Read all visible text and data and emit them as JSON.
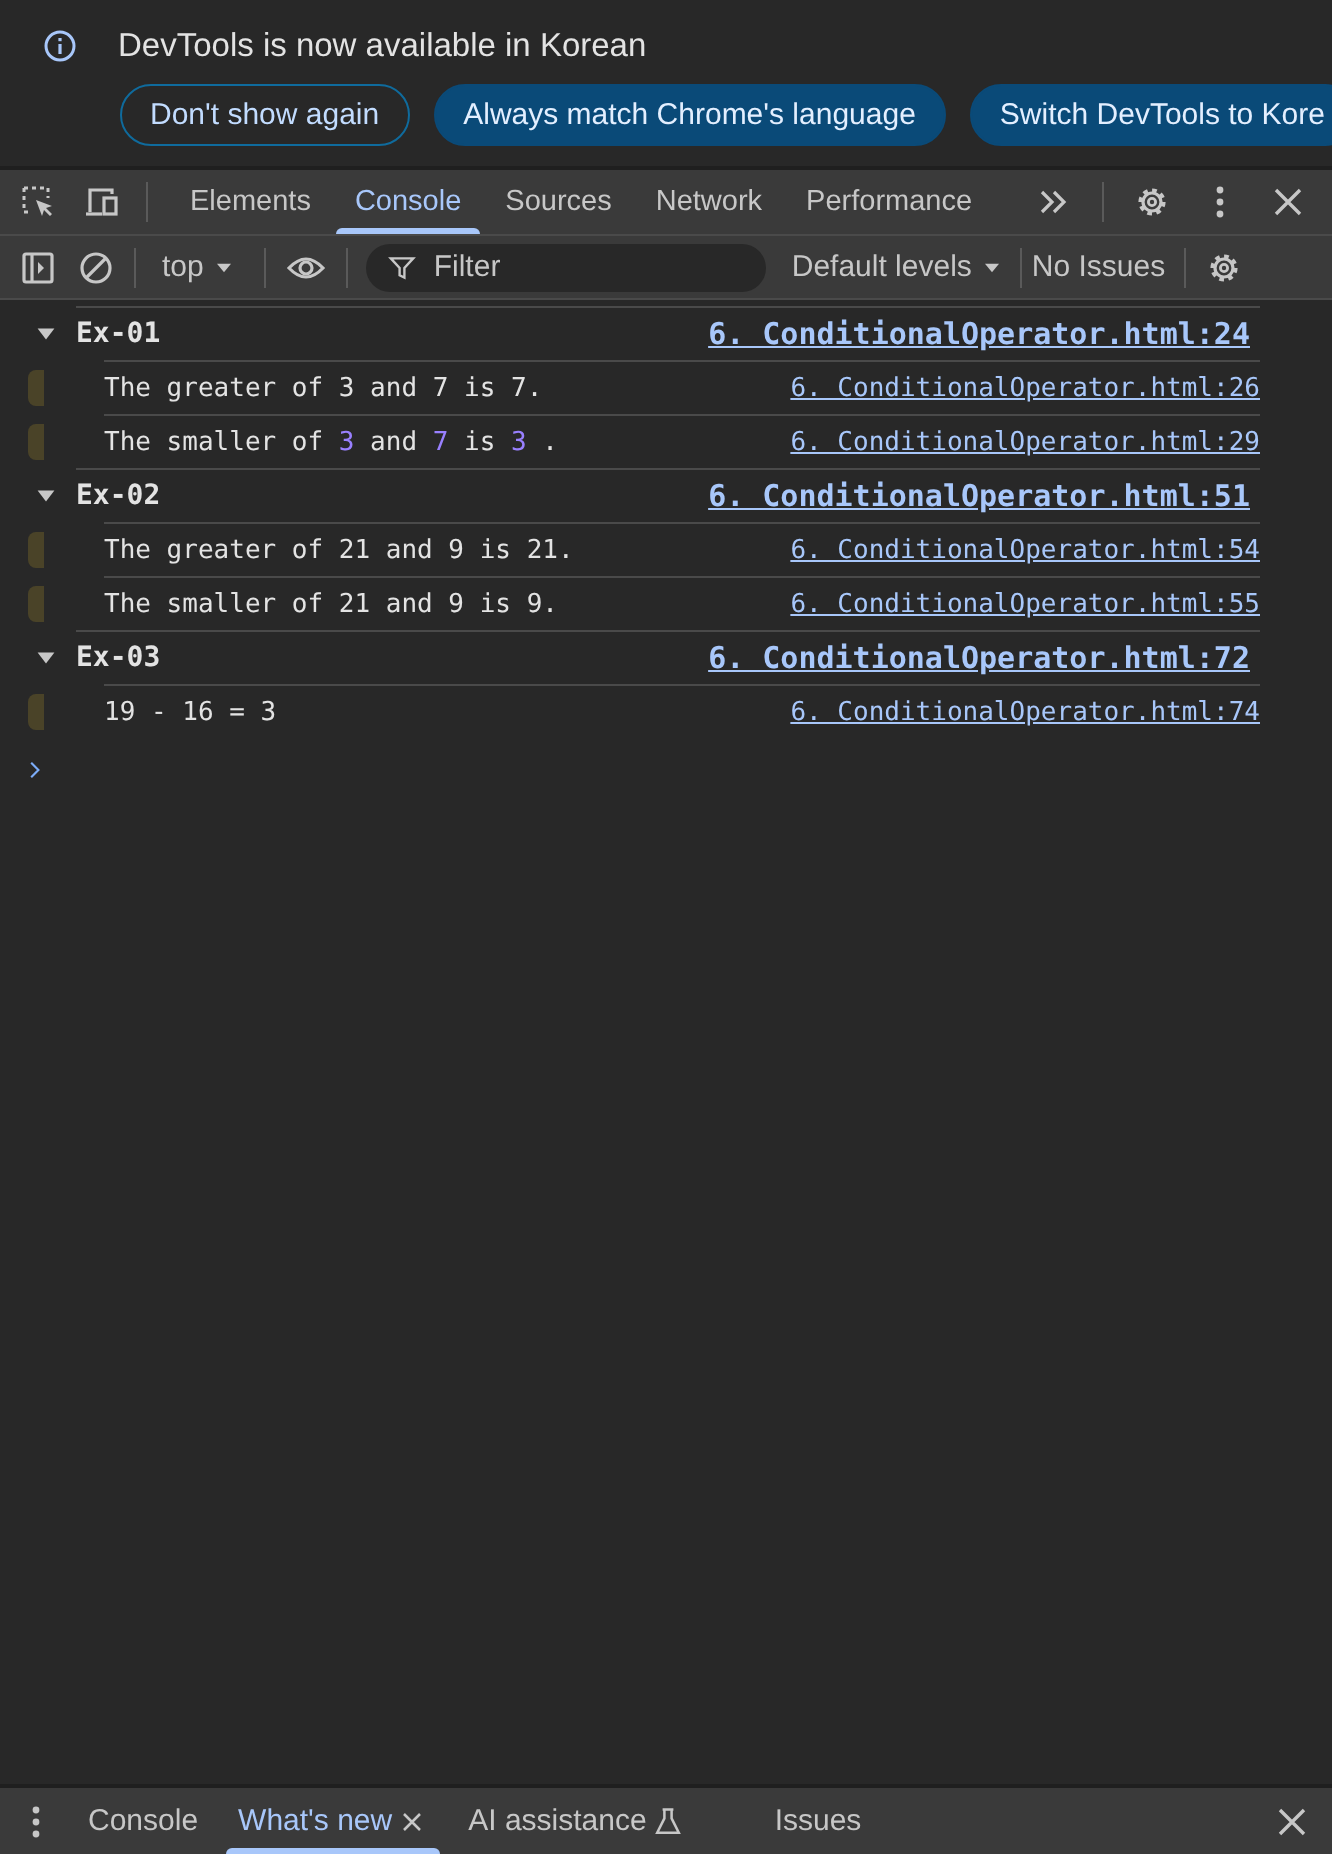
{
  "notification": {
    "message": "DevTools is now available in Korean",
    "buttons": [
      {
        "label": "Don't show again",
        "kind": "outline"
      },
      {
        "label": "Always match Chrome's language",
        "kind": "filled"
      },
      {
        "label": "Switch DevTools to Kore",
        "kind": "filled"
      }
    ]
  },
  "main_tabs": [
    {
      "label": "Elements",
      "selected": false
    },
    {
      "label": "Console",
      "selected": true
    },
    {
      "label": "Sources",
      "selected": false
    },
    {
      "label": "Network",
      "selected": false
    },
    {
      "label": "Performance",
      "selected": false
    }
  ],
  "console_toolbar": {
    "context": "top",
    "filter": {
      "placeholder": "Filter"
    },
    "levels": "Default levels",
    "issues": "No Issues"
  },
  "console": {
    "groups": [
      {
        "label": "Ex-01",
        "expanded": true,
        "source": "6. ConditionalOperator.html:24",
        "messages": [
          {
            "segments": [
              {
                "text": "The greater of 3 and 7 is 7.",
                "kind": "string"
              }
            ],
            "source": "6. ConditionalOperator.html:26"
          },
          {
            "segments": [
              {
                "text": "The smaller of ",
                "kind": "string"
              },
              {
                "text": "3",
                "kind": "number"
              },
              {
                "text": " and ",
                "kind": "string"
              },
              {
                "text": "7",
                "kind": "number"
              },
              {
                "text": " is ",
                "kind": "string"
              },
              {
                "text": "3",
                "kind": "number"
              },
              {
                "text": " .",
                "kind": "string"
              }
            ],
            "source": "6. ConditionalOperator.html:29"
          }
        ]
      },
      {
        "label": "Ex-02",
        "expanded": true,
        "source": "6. ConditionalOperator.html:51",
        "messages": [
          {
            "segments": [
              {
                "text": "The greater of 21 and 9 is 21.",
                "kind": "string"
              }
            ],
            "source": "6. ConditionalOperator.html:54"
          },
          {
            "segments": [
              {
                "text": "The smaller of 21 and 9 is 9.",
                "kind": "string"
              }
            ],
            "source": "6. ConditionalOperator.html:55"
          }
        ]
      },
      {
        "label": "Ex-03",
        "expanded": true,
        "source": "6. ConditionalOperator.html:72",
        "messages": [
          {
            "segments": [
              {
                "text": "19 - 16 = 3",
                "kind": "string"
              }
            ],
            "source": "6. ConditionalOperator.html:74"
          }
        ]
      }
    ]
  },
  "drawer_tabs": [
    {
      "label": "Console",
      "selected": false,
      "closable": false,
      "experimental": false
    },
    {
      "label": "What's new",
      "selected": true,
      "closable": true,
      "experimental": false
    },
    {
      "label": "AI assistance",
      "selected": false,
      "closable": false,
      "experimental": true
    },
    {
      "label": "Issues",
      "selected": false,
      "closable": false,
      "experimental": false
    }
  ]
}
